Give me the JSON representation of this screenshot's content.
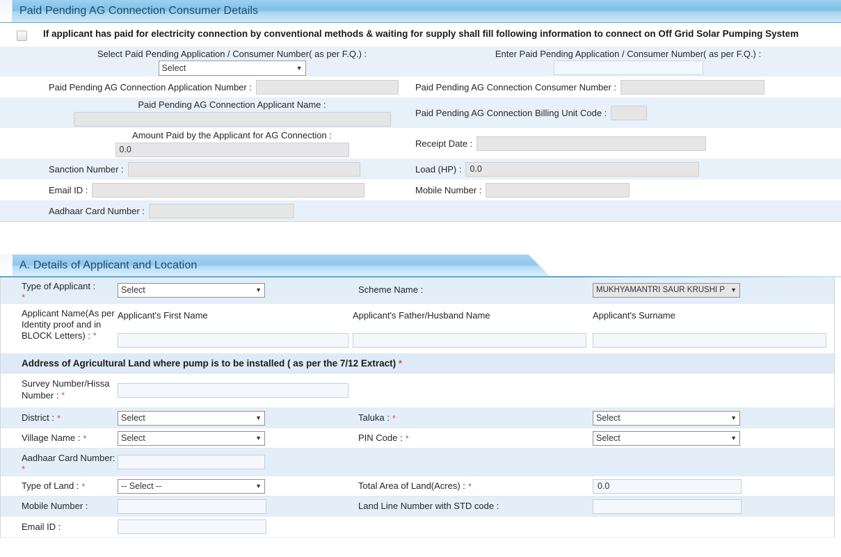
{
  "section1": {
    "title": "Paid Pending AG Connection Consumer Details",
    "notice": "If applicant has paid for electricity connection by conventional methods & waiting for supply shall fill following information to connect on Off Grid Solar Pumping System",
    "rows": {
      "select_paid_pending_label": "Select Paid Pending Application / Consumer Number( as per F.Q.) :",
      "select_paid_pending_value": "Select",
      "enter_paid_pending_label": "Enter Paid Pending Application / Consumer Number( as per F.Q.) :",
      "enter_paid_pending_value": "",
      "application_number_label": "Paid Pending AG Connection Application Number :",
      "application_number_value": "",
      "consumer_number_label": "Paid Pending AG Connection Consumer Number :",
      "consumer_number_value": "",
      "applicant_name_label": "Paid Pending AG Connection Applicant Name :",
      "applicant_name_value": "",
      "billing_unit_label": "Paid Pending AG Connection Billing Unit Code :",
      "billing_unit_value": "",
      "amount_paid_label": "Amount Paid by the Applicant for AG Connection :",
      "amount_paid_value": "0.0",
      "receipt_date_label": "Receipt Date :",
      "receipt_date_value": "",
      "sanction_number_label": "Sanction Number :",
      "sanction_number_value": "",
      "load_hp_label": "Load (HP) :",
      "load_hp_value": "0.0",
      "email_label": "Email ID :",
      "email_value": "",
      "mobile_label": "Mobile Number :",
      "mobile_value": "",
      "aadhaar_label": "Aadhaar Card Number :",
      "aadhaar_value": ""
    }
  },
  "sectionA": {
    "title": "A. Details of Applicant and Location",
    "type_of_applicant_label": "Type of Applicant :",
    "type_of_applicant_value": "Select",
    "scheme_name_label": "Scheme Name :",
    "scheme_name_value": "MUKHYAMANTRI SAUR KRUSHI P",
    "applicant_name_label": "Applicant Name(As per Identity proof and in BLOCK Letters) :",
    "first_name_header": "Applicant's First Name",
    "father_name_header": "Applicant's Father/Husband Name",
    "surname_header": "Applicant's Surname",
    "first_name_value": "",
    "father_name_value": "",
    "surname_value": "",
    "address_band": "Address of Agricultural Land where pump is to be installed ( as per the 7/12 Extract)",
    "survey_number_label": "Survey Number/Hissa Number :",
    "survey_number_value": "",
    "district_label": "District :",
    "district_value": "Select",
    "taluka_label": "Taluka :",
    "taluka_value": "Select",
    "village_label": "Village Name :",
    "village_value": "Select",
    "pin_code_label": "PIN Code :",
    "pin_code_value": "Select",
    "aadhaar_label": "Aadhaar Card Number:",
    "aadhaar_value": "",
    "type_of_land_label": "Type of Land :",
    "type_of_land_value": "-- Select --",
    "total_area_label": "Total Area of Land(Acres) :",
    "total_area_value": "0.0",
    "mobile_label": "Mobile Number :",
    "mobile_value": "",
    "landline_label": "Land Line Number with STD code :",
    "landline_value": "",
    "email_label": "Email ID :",
    "email_value": "",
    "required_marker": "*"
  },
  "colors": {
    "header_blue": "#8ec8ea",
    "row_alt": "#e4eef9",
    "required_red": "#d94f4f"
  }
}
